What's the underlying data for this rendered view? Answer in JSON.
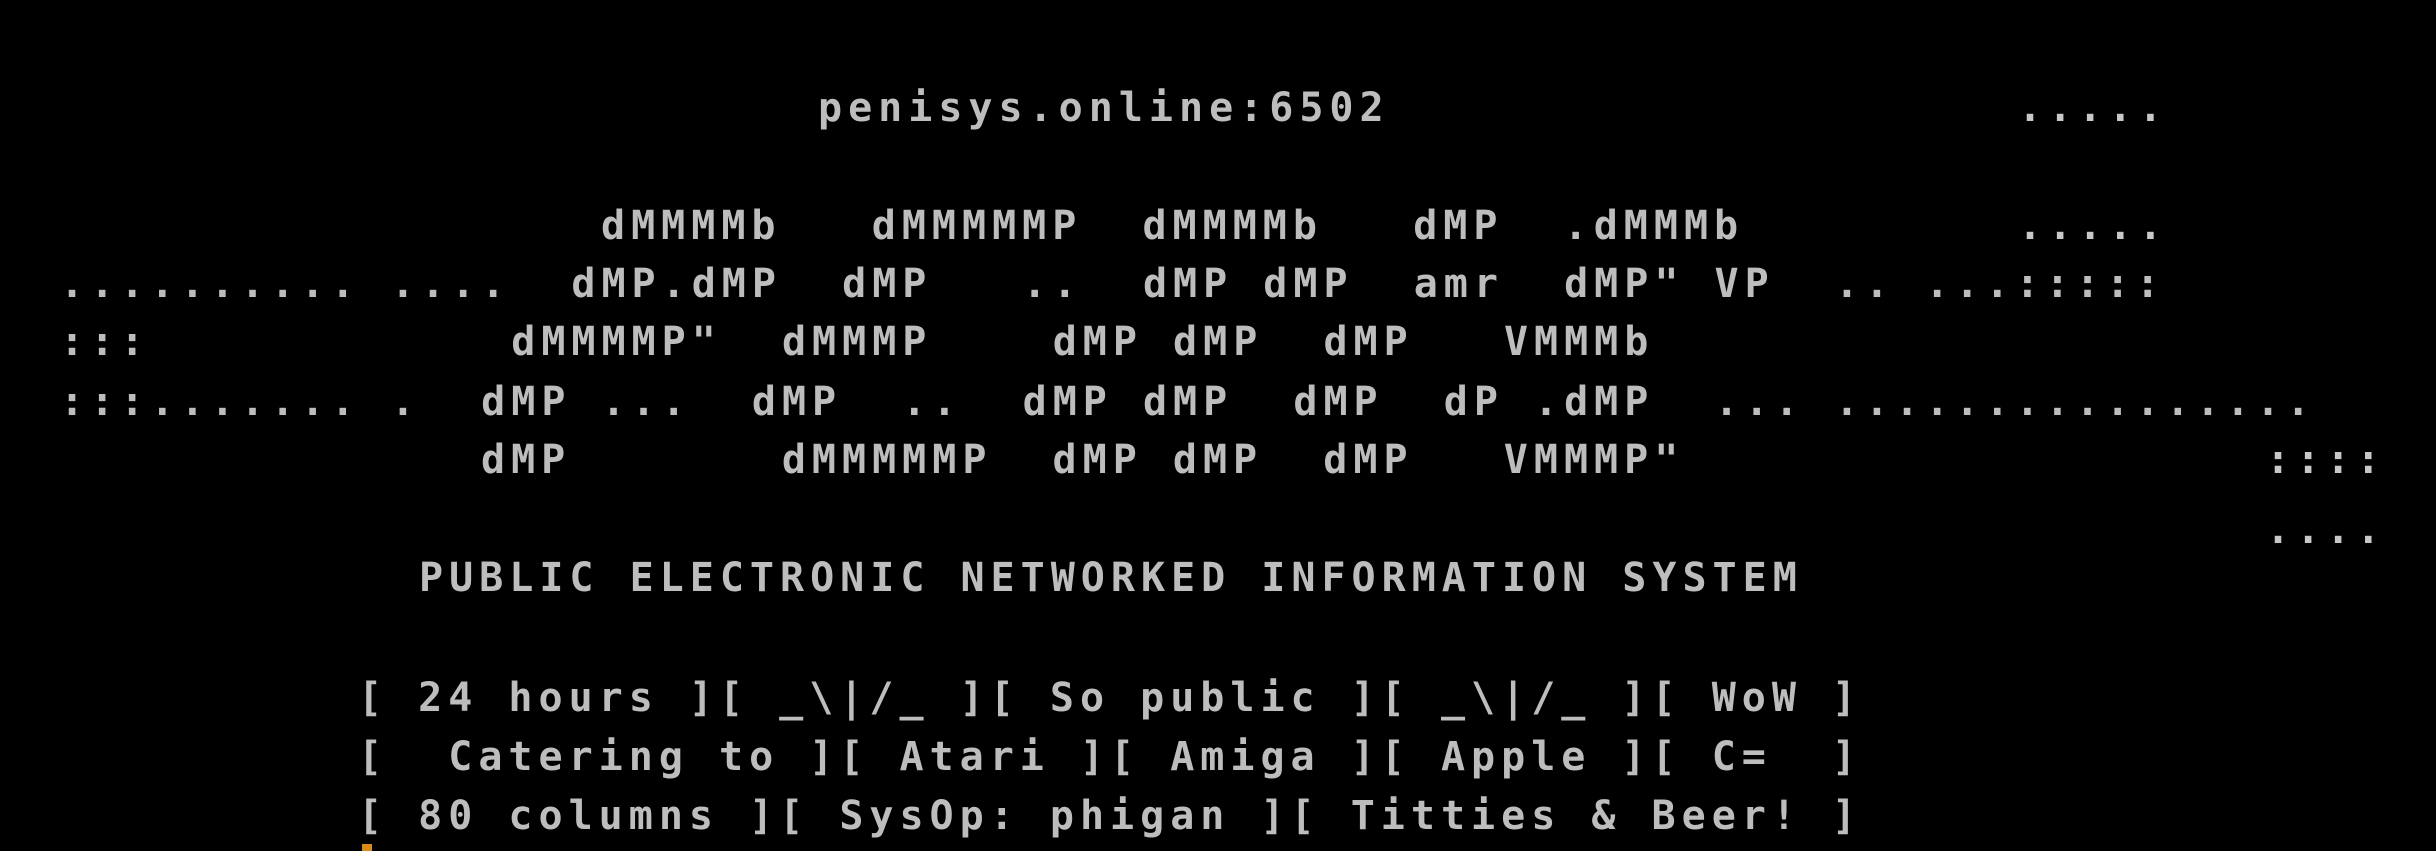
{
  "terminal": {
    "host": "penisys.online:6502",
    "side_dots": [
      ".....",
      ".....",
      "::::",
      "...."
    ],
    "logo_lines": [
      "dMMMMb   dMMMMMP  dMMMMb   dMP  .dMMMb",
      ".......... ....  dMP.dMP  dMP   ..  dMP dMP  amr  dMP\" VP  .. ...:::::",
      ":::            dMMMMP\"  dMMMP    dMP dMP  dMP   VMMMb",
      ":::....... .  dMP ...  dMP  ..  dMP dMP  dMP  dP .dMP  ... ................",
      "dMP       dMMMMMP  dMP dMP  dMP   VMMMP\""
    ],
    "system_name": "PUBLIC ELECTRONIC NETWORKED INFORMATION SYSTEM",
    "info_lines": [
      "[ 24 hours ][ _\\|/_ ][ So public ][ _\\|/_ ][ WoW ]",
      "[  Catering to ][ Atari ][ Amiga ][ Apple ][ C=  ]",
      "[ 80 columns ][ SysOp: phigan ][ Titties & Beer! ]"
    ]
  },
  "colors": {
    "background": "#000000",
    "text": "#bdbdbd",
    "cursor": "#d88a1a"
  }
}
